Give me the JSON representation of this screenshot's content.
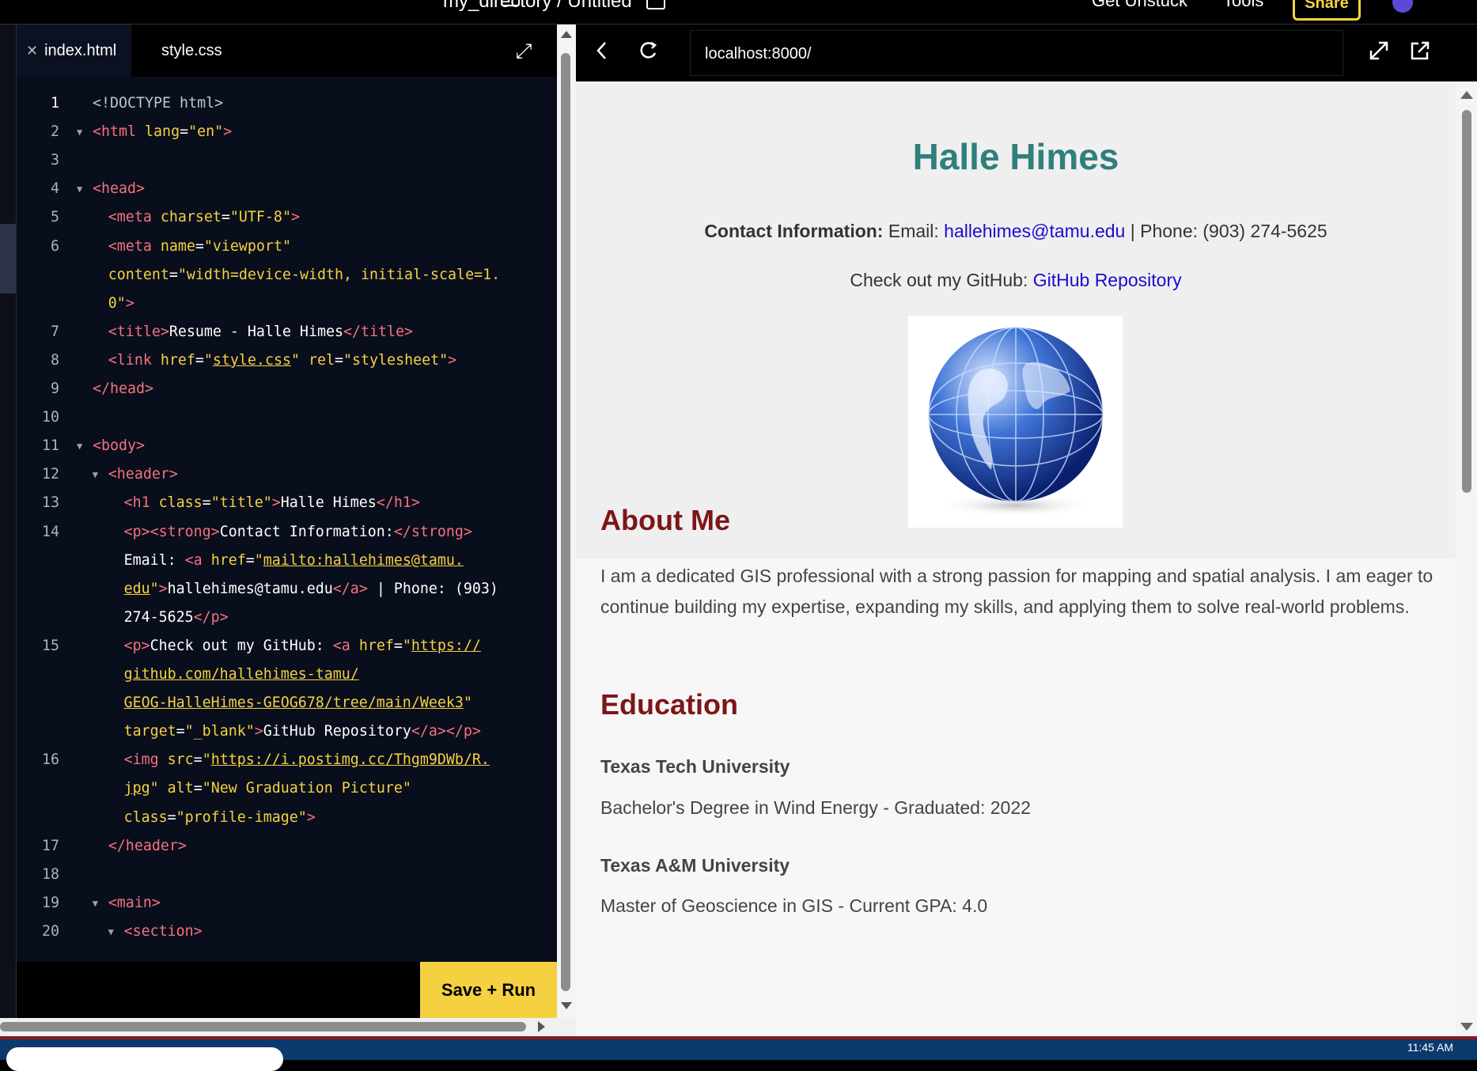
{
  "topbar": {
    "path": "my_directory / Untitled",
    "get_unstuck": "Get Unstuck",
    "tools": "Tools",
    "share": "Share"
  },
  "editor": {
    "tabs": [
      {
        "label": "index.html",
        "active": true,
        "close_icon": "close-icon"
      },
      {
        "label": "style.css",
        "active": false
      }
    ],
    "expand_icon": "expand-icon",
    "save_run": "Save + Run"
  },
  "code_lines": [
    {
      "num": "1",
      "fold": false,
      "indent": 0,
      "parts": [
        {
          "c": "d",
          "t": "<!DOCTYPE html>"
        }
      ]
    },
    {
      "num": "2",
      "fold": true,
      "indent": 0,
      "parts": [
        {
          "c": "t",
          "t": "<html "
        },
        {
          "c": "a",
          "t": "lang"
        },
        {
          "c": "p",
          "t": "="
        },
        {
          "c": "s",
          "t": "\"en\""
        },
        {
          "c": "t",
          "t": ">"
        }
      ]
    },
    {
      "num": "3",
      "fold": false,
      "indent": 0,
      "parts": []
    },
    {
      "num": "4",
      "fold": true,
      "indent": 0,
      "parts": [
        {
          "c": "t",
          "t": "<head>"
        }
      ]
    },
    {
      "num": "5",
      "fold": false,
      "indent": 1,
      "parts": [
        {
          "c": "t",
          "t": "<meta "
        },
        {
          "c": "a",
          "t": "charset"
        },
        {
          "c": "p",
          "t": "="
        },
        {
          "c": "s",
          "t": "\"UTF-8\""
        },
        {
          "c": "t",
          "t": ">"
        }
      ]
    },
    {
      "num": "6",
      "fold": false,
      "indent": 1,
      "parts": [
        {
          "c": "t",
          "t": "<meta "
        },
        {
          "c": "a",
          "t": "name"
        },
        {
          "c": "p",
          "t": "="
        },
        {
          "c": "s",
          "t": "\"viewport\""
        }
      ]
    },
    {
      "num": "",
      "fold": false,
      "indent": 1,
      "parts": [
        {
          "c": "a",
          "t": "content"
        },
        {
          "c": "p",
          "t": "="
        },
        {
          "c": "s",
          "t": "\"width=device-width, initial-scale=1."
        }
      ]
    },
    {
      "num": "",
      "fold": false,
      "indent": 1,
      "parts": [
        {
          "c": "s",
          "t": "0\""
        },
        {
          "c": "t",
          "t": ">"
        }
      ]
    },
    {
      "num": "7",
      "fold": false,
      "indent": 1,
      "parts": [
        {
          "c": "t",
          "t": "<title>"
        },
        {
          "c": "p",
          "t": "Resume - Halle Himes"
        },
        {
          "c": "t",
          "t": "</title>"
        }
      ]
    },
    {
      "num": "8",
      "fold": false,
      "indent": 1,
      "parts": [
        {
          "c": "t",
          "t": "<link "
        },
        {
          "c": "a",
          "t": "href"
        },
        {
          "c": "p",
          "t": "="
        },
        {
          "c": "s",
          "t": "\""
        },
        {
          "c": "s u",
          "t": "style.css"
        },
        {
          "c": "s",
          "t": "\""
        },
        {
          "c": "a",
          "t": " rel"
        },
        {
          "c": "p",
          "t": "="
        },
        {
          "c": "s",
          "t": "\"stylesheet\""
        },
        {
          "c": "t",
          "t": ">"
        }
      ]
    },
    {
      "num": "9",
      "fold": false,
      "indent": 0,
      "parts": [
        {
          "c": "t",
          "t": "</head>"
        }
      ]
    },
    {
      "num": "10",
      "fold": false,
      "indent": 0,
      "parts": []
    },
    {
      "num": "11",
      "fold": true,
      "indent": 0,
      "parts": [
        {
          "c": "t",
          "t": "<body>"
        }
      ]
    },
    {
      "num": "12",
      "fold": true,
      "indent": 1,
      "parts": [
        {
          "c": "t",
          "t": "<header>"
        }
      ]
    },
    {
      "num": "13",
      "fold": false,
      "indent": 2,
      "parts": [
        {
          "c": "t",
          "t": "<h1 "
        },
        {
          "c": "a",
          "t": "class"
        },
        {
          "c": "p",
          "t": "="
        },
        {
          "c": "s",
          "t": "\"title\""
        },
        {
          "c": "t",
          "t": ">"
        },
        {
          "c": "p",
          "t": "Halle Himes"
        },
        {
          "c": "t",
          "t": "</h1>"
        }
      ]
    },
    {
      "num": "14",
      "fold": false,
      "indent": 2,
      "parts": [
        {
          "c": "t",
          "t": "<p><strong>"
        },
        {
          "c": "p",
          "t": "Contact Information:"
        },
        {
          "c": "t",
          "t": "</strong>"
        }
      ]
    },
    {
      "num": "",
      "fold": false,
      "indent": 2,
      "parts": [
        {
          "c": "p",
          "t": "Email: "
        },
        {
          "c": "t",
          "t": "<a "
        },
        {
          "c": "a",
          "t": "href"
        },
        {
          "c": "p",
          "t": "="
        },
        {
          "c": "s",
          "t": "\""
        },
        {
          "c": "s u",
          "t": "mailto:hallehimes@tamu."
        }
      ]
    },
    {
      "num": "",
      "fold": false,
      "indent": 2,
      "parts": [
        {
          "c": "s u",
          "t": "edu"
        },
        {
          "c": "s",
          "t": "\""
        },
        {
          "c": "t",
          "t": ">"
        },
        {
          "c": "p",
          "t": "hallehimes@tamu.edu"
        },
        {
          "c": "t",
          "t": "</a>"
        },
        {
          "c": "p",
          "t": " | Phone: (903)"
        }
      ]
    },
    {
      "num": "",
      "fold": false,
      "indent": 2,
      "parts": [
        {
          "c": "p",
          "t": "274-5625"
        },
        {
          "c": "t",
          "t": "</p>"
        }
      ]
    },
    {
      "num": "15",
      "fold": false,
      "indent": 2,
      "parts": [
        {
          "c": "t",
          "t": "<p>"
        },
        {
          "c": "p",
          "t": "Check out my GitHub: "
        },
        {
          "c": "t",
          "t": "<a "
        },
        {
          "c": "a",
          "t": "href"
        },
        {
          "c": "p",
          "t": "="
        },
        {
          "c": "s",
          "t": "\""
        },
        {
          "c": "s u",
          "t": "https://"
        }
      ]
    },
    {
      "num": "",
      "fold": false,
      "indent": 2,
      "parts": [
        {
          "c": "s u",
          "t": "github.com/hallehimes-tamu/"
        }
      ]
    },
    {
      "num": "",
      "fold": false,
      "indent": 2,
      "parts": [
        {
          "c": "s u",
          "t": "GEOG-HalleHimes-GEOG678/tree/main/Week3"
        },
        {
          "c": "s",
          "t": "\""
        }
      ]
    },
    {
      "num": "",
      "fold": false,
      "indent": 2,
      "parts": [
        {
          "c": "a",
          "t": "target"
        },
        {
          "c": "p",
          "t": "="
        },
        {
          "c": "s",
          "t": "\"_blank\""
        },
        {
          "c": "t",
          "t": ">"
        },
        {
          "c": "p",
          "t": "GitHub Repository"
        },
        {
          "c": "t",
          "t": "</a></p>"
        }
      ]
    },
    {
      "num": "16",
      "fold": false,
      "indent": 2,
      "parts": [
        {
          "c": "t",
          "t": "<img "
        },
        {
          "c": "a",
          "t": "src"
        },
        {
          "c": "p",
          "t": "="
        },
        {
          "c": "s",
          "t": "\""
        },
        {
          "c": "s u",
          "t": "https://i.postimg.cc/Thgm9DWb/R."
        }
      ]
    },
    {
      "num": "",
      "fold": false,
      "indent": 2,
      "parts": [
        {
          "c": "s u",
          "t": "jpg"
        },
        {
          "c": "s",
          "t": "\""
        },
        {
          "c": "a",
          "t": " alt"
        },
        {
          "c": "p",
          "t": "="
        },
        {
          "c": "s",
          "t": "\"New Graduation Picture\""
        }
      ]
    },
    {
      "num": "",
      "fold": false,
      "indent": 2,
      "parts": [
        {
          "c": "a",
          "t": "class"
        },
        {
          "c": "p",
          "t": "="
        },
        {
          "c": "s",
          "t": "\"profile-image\""
        },
        {
          "c": "t",
          "t": ">"
        }
      ]
    },
    {
      "num": "17",
      "fold": false,
      "indent": 1,
      "parts": [
        {
          "c": "t",
          "t": "</header>"
        }
      ]
    },
    {
      "num": "18",
      "fold": false,
      "indent": 0,
      "parts": []
    },
    {
      "num": "19",
      "fold": true,
      "indent": 1,
      "parts": [
        {
          "c": "t",
          "t": "<main>"
        }
      ]
    },
    {
      "num": "20",
      "fold": true,
      "indent": 2,
      "parts": [
        {
          "c": "t",
          "t": "<section>"
        }
      ]
    }
  ],
  "browser": {
    "url": "localhost:8000/",
    "back_icon": "back-arrow-icon",
    "reload_icon": "reload-icon",
    "expand_icon": "expand-icon",
    "open_external_icon": "open-external-icon"
  },
  "page": {
    "name": "Halle Himes",
    "contact_label": "Contact Information:",
    "email_label": "Email: ",
    "email": "hallehimes@tamu.edu",
    "phone_text": " | Phone: (903) 274-5625",
    "github_label": "Check out my GitHub: ",
    "github_link": "GitHub Repository",
    "image_alt": "New Graduation Picture",
    "about_heading": "About Me",
    "about_text": "I am a dedicated GIS professional with a strong passion for mapping and spatial analysis. I am eager to continue building my expertise, expanding my skills, and applying them to solve real-world problems.",
    "education_heading": "Education",
    "schools": [
      {
        "name": "Texas Tech University",
        "detail": "Bachelor's Degree in Wind Energy - Graduated: 2022"
      },
      {
        "name": "Texas A&M University",
        "detail": "Master of Geoscience in GIS - Current GPA: 4.0"
      }
    ]
  },
  "taskbar": {
    "clock": "11:45 AM"
  }
}
